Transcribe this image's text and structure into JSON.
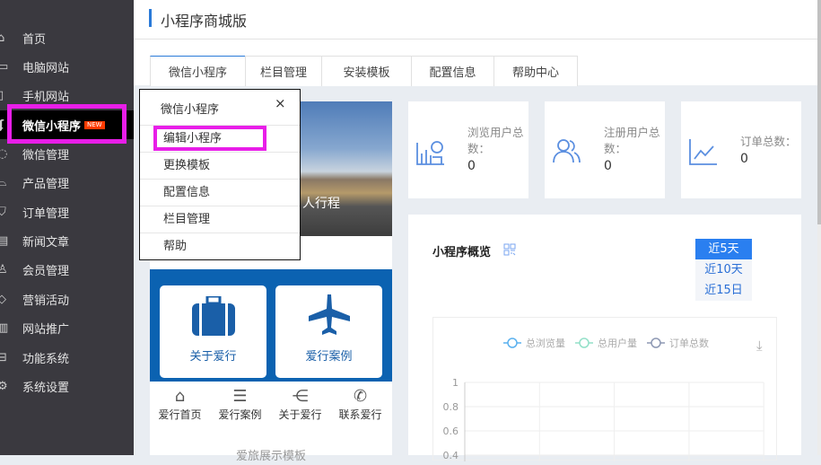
{
  "sidebar": {
    "items": [
      {
        "label": "首页",
        "icon": "home-icon",
        "glyph": "⌂"
      },
      {
        "label": "电脑网站",
        "icon": "monitor-icon",
        "glyph": "▭"
      },
      {
        "label": "手机网站",
        "icon": "phone-icon",
        "glyph": "▯"
      },
      {
        "label": "微信小程序",
        "icon": "miniprogram-icon",
        "glyph": "ʆ",
        "badge": "NEW"
      },
      {
        "label": "微信管理",
        "icon": "wechat-icon",
        "glyph": "◌"
      },
      {
        "label": "产品管理",
        "icon": "bag-icon",
        "glyph": "⌓"
      },
      {
        "label": "订单管理",
        "icon": "cart-icon",
        "glyph": "⛉"
      },
      {
        "label": "新闻文章",
        "icon": "document-icon",
        "glyph": "▤"
      },
      {
        "label": "会员管理",
        "icon": "user-icon",
        "glyph": "♙"
      },
      {
        "label": "营销活动",
        "icon": "tag-icon",
        "glyph": "◇"
      },
      {
        "label": "网站推广",
        "icon": "bar-chart-icon",
        "glyph": "▥"
      },
      {
        "label": "功能系统",
        "icon": "toolbox-icon",
        "glyph": "⊟"
      },
      {
        "label": "系统设置",
        "icon": "gear-icon",
        "glyph": "⚙"
      }
    ]
  },
  "header": {
    "title": "小程序商城版"
  },
  "tabs": [
    "微信小程序",
    "栏目管理",
    "安装模板",
    "配置信息",
    "帮助中心"
  ],
  "popup": {
    "title": "微信小程序",
    "close": "×",
    "items": [
      "编辑小程序",
      "更换模板",
      "配置信息",
      "栏目管理",
      "帮助"
    ]
  },
  "preview": {
    "banner_text": "人行程",
    "cards": [
      "关于爱行",
      "爱行案例"
    ],
    "nav": [
      "爱行首页",
      "爱行案例",
      "关于爱行",
      "联系爱行"
    ],
    "template_name": "爱旅展示模板"
  },
  "stats": [
    {
      "label": "浏览用户总数：",
      "value": "0"
    },
    {
      "label": "注册用户总数：",
      "value": "0"
    },
    {
      "label": "订单总数：",
      "value": "0"
    }
  ],
  "overview": {
    "title": "小程序概览",
    "ranges": [
      "近5天",
      "近10天",
      "近15日"
    ],
    "selected": "近5天"
  },
  "chart_data": {
    "type": "line",
    "legend": [
      "总浏览量",
      "总用户量",
      "订单总数"
    ],
    "legend_colors": [
      "#5ab1ef",
      "#93e0c8",
      "#8d98b3"
    ],
    "yticks": [
      "1",
      "0.8",
      "0.6",
      "0.4"
    ],
    "ylim": [
      0,
      1
    ],
    "series": []
  }
}
